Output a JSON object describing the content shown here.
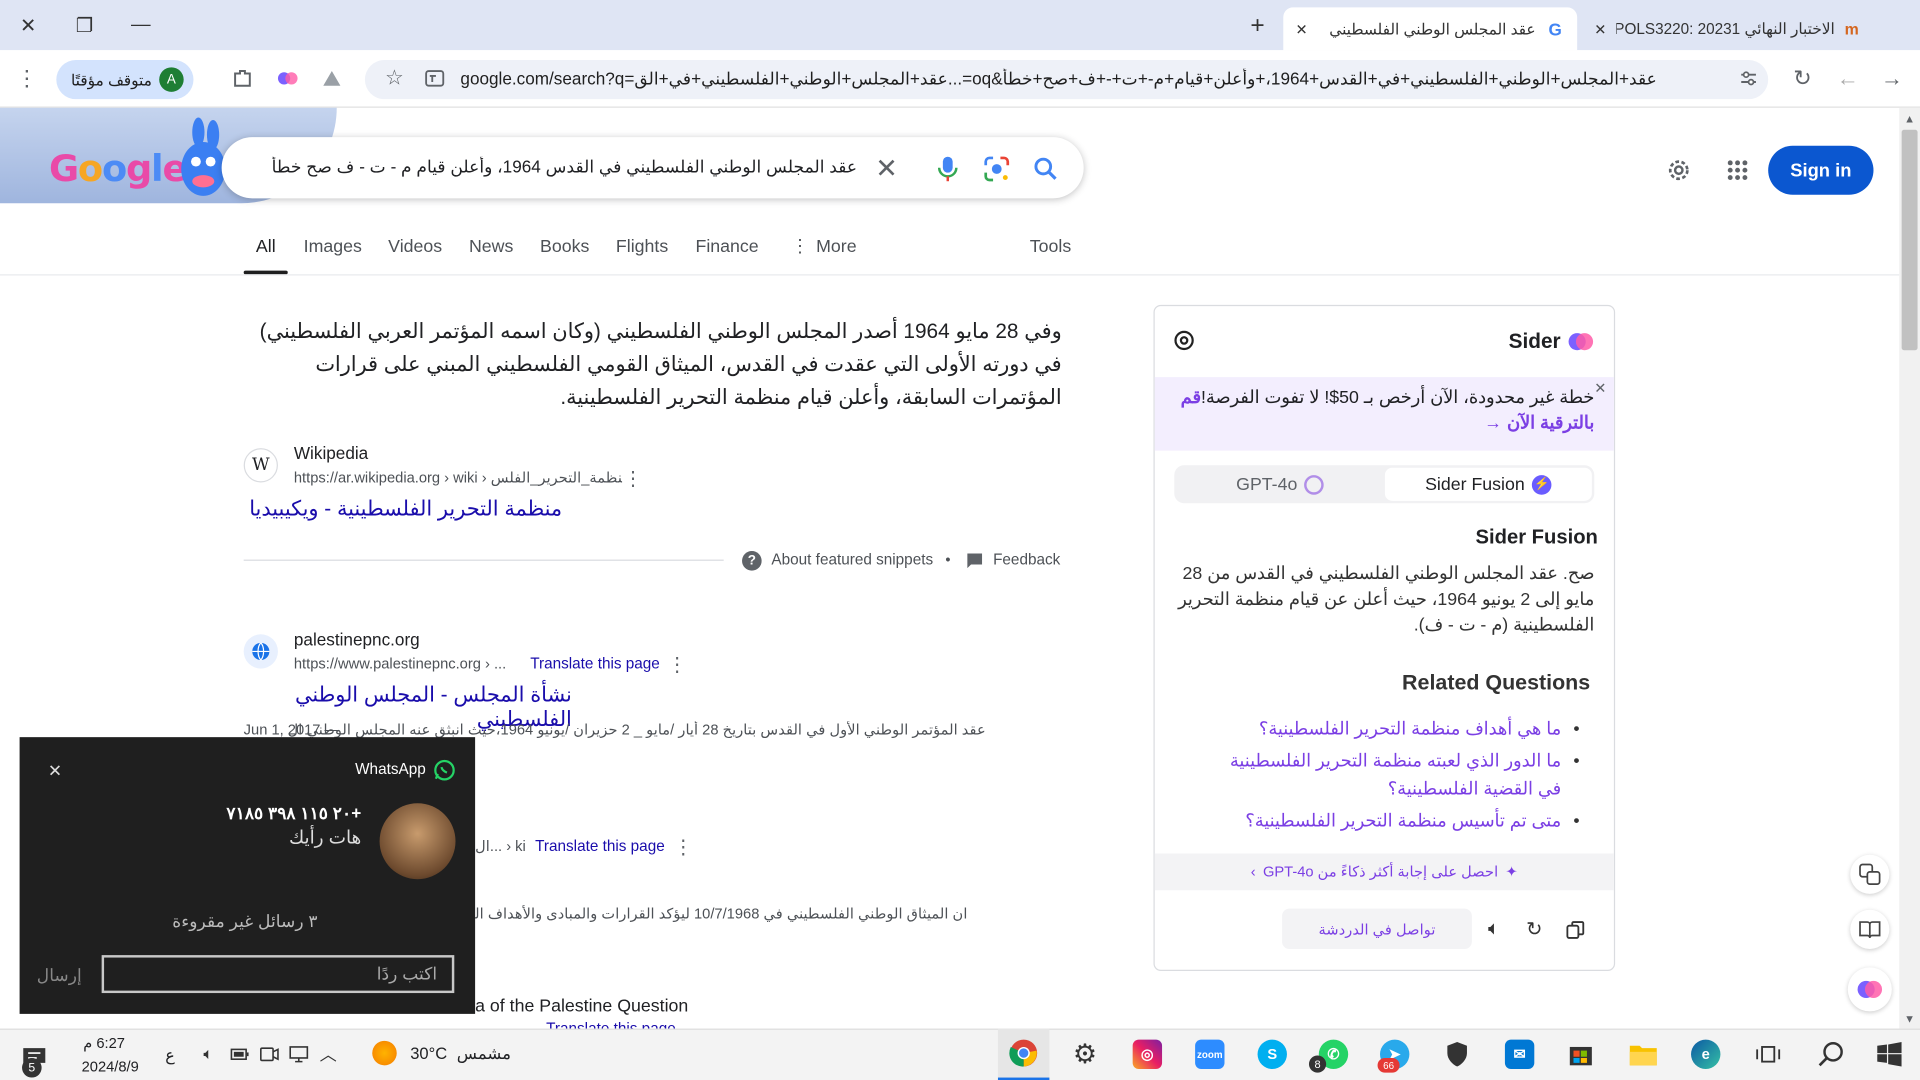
{
  "browser": {
    "tabs": [
      {
        "title": "الاختبار النهائي POLS3220: 20231"
      },
      {
        "title": "عقد المجلس الوطني الفلسطيني"
      }
    ],
    "new_tab_symbol": "+",
    "url": "google.com/search?q=عقد+المجلس+الوطني+الفلسطيني+في+الق...=oq&عقد+المجلس+الوطني+الفلسطيني+في+القدس+1964،+وأعلن+قيام+م-+ت+-+ف+صح+خطأ",
    "profile_label": "متوقف مؤقتًا",
    "profile_initial": "A"
  },
  "google": {
    "search_query": "عقد المجلس الوطني الفلسطيني في القدس 1964، وأعلن قيام م - ت - ف صح خطأ",
    "sign_in": "Sign in",
    "nav_tabs": [
      "All",
      "Images",
      "Videos",
      "News",
      "Books",
      "Flights",
      "Finance",
      "More"
    ],
    "tools": "Tools"
  },
  "snippet": {
    "text": "وفي 28 مايو 1964 أصدر المجلس الوطني الفلسطيني (وكان اسمه المؤتمر العربي الفلسطيني) في دورته الأولى التي عقدت في القدس، الميثاق القومي الفلسطيني المبني على قرارات المؤتمرات السابقة، وأعلن قيام منظمة التحرير الفلسطينية.",
    "source_name": "Wikipedia",
    "source_url": "https://ar.wikipedia.org › wiki › منظمة_التحرير_الفلس...",
    "link_title": "منظمة التحرير الفلسطينية - ويكيبيديا",
    "about": "About featured snippets",
    "feedback": "Feedback"
  },
  "results": [
    {
      "site": "palestinepnc.org",
      "url": "https://www.palestinepnc.org › ...",
      "translate": "Translate this page",
      "title": "نشأة المجلس - المجلس الوطني الفلسطيني",
      "date": "Jun 1, 2017 —",
      "snippet": "عقد المؤتمر الوطني الأول في القدس بتاريخ 28 أيار /مايو _ 2 حزيران /يونيو 1964،حيث انبثق عنه المجلس الوطني ال"
    },
    {
      "url_tail": "ال... › ki",
      "translate": "Translate this page",
      "snippet": "ان الميثاق الوطني الفلسطيني في 10/7/1968 ليؤكد القرارات والمبادى والأهداف العرب"
    },
    {
      "title": "a of the Palestine Question",
      "translate": "Translate this page"
    }
  ],
  "sider": {
    "brand": "Sider",
    "promo_text": "خطة غير محدودة، الآن أرخص بـ 50$! لا تفوت الفرصة!",
    "promo_link": "قم بالترقية الآن →",
    "model_a": "GPT-4o",
    "model_b": "Sider Fusion",
    "answer_title": "Sider Fusion",
    "answer": "صح. عقد المجلس الوطني الفلسطيني في القدس من 28 مايو إلى 2 يونيو 1964، حيث أعلن عن قيام منظمة التحرير الفلسطينية (م - ت - ف).",
    "related_title": "Related Questions",
    "related": [
      "ما هي أهداف منظمة التحرير الفلسطينية؟",
      "ما الدور الذي لعبته منظمة التحرير الفلسطينية في القضية الفلسطينية؟",
      "متى تم تأسيس منظمة التحرير الفلسطينية؟"
    ],
    "smarter": "احصل على إجابة أكثر ذكاءً من GPT-4o",
    "continue": "تواصل في الدردشة"
  },
  "whatsapp": {
    "app": "WhatsApp",
    "phone": "+٢٠ ١١٥ ٣٩٨ ٧١٨٥",
    "message": "هات رأيك",
    "unread": "٣ رسائل غير مقروءة",
    "reply_placeholder": "اكتب ردًا",
    "send": "إرسال"
  },
  "taskbar": {
    "time": "6:27 م",
    "date": "2024/8/9",
    "weather_temp": "30°C",
    "weather_text": "مشمس",
    "lang": "ع",
    "notif_count": "5",
    "whatsapp_badge": "8",
    "telegram_badge": "66"
  },
  "colors": {
    "accent": "#0b57d0",
    "link": "#1a0dab",
    "sider_purple": "#8a4fe0"
  }
}
